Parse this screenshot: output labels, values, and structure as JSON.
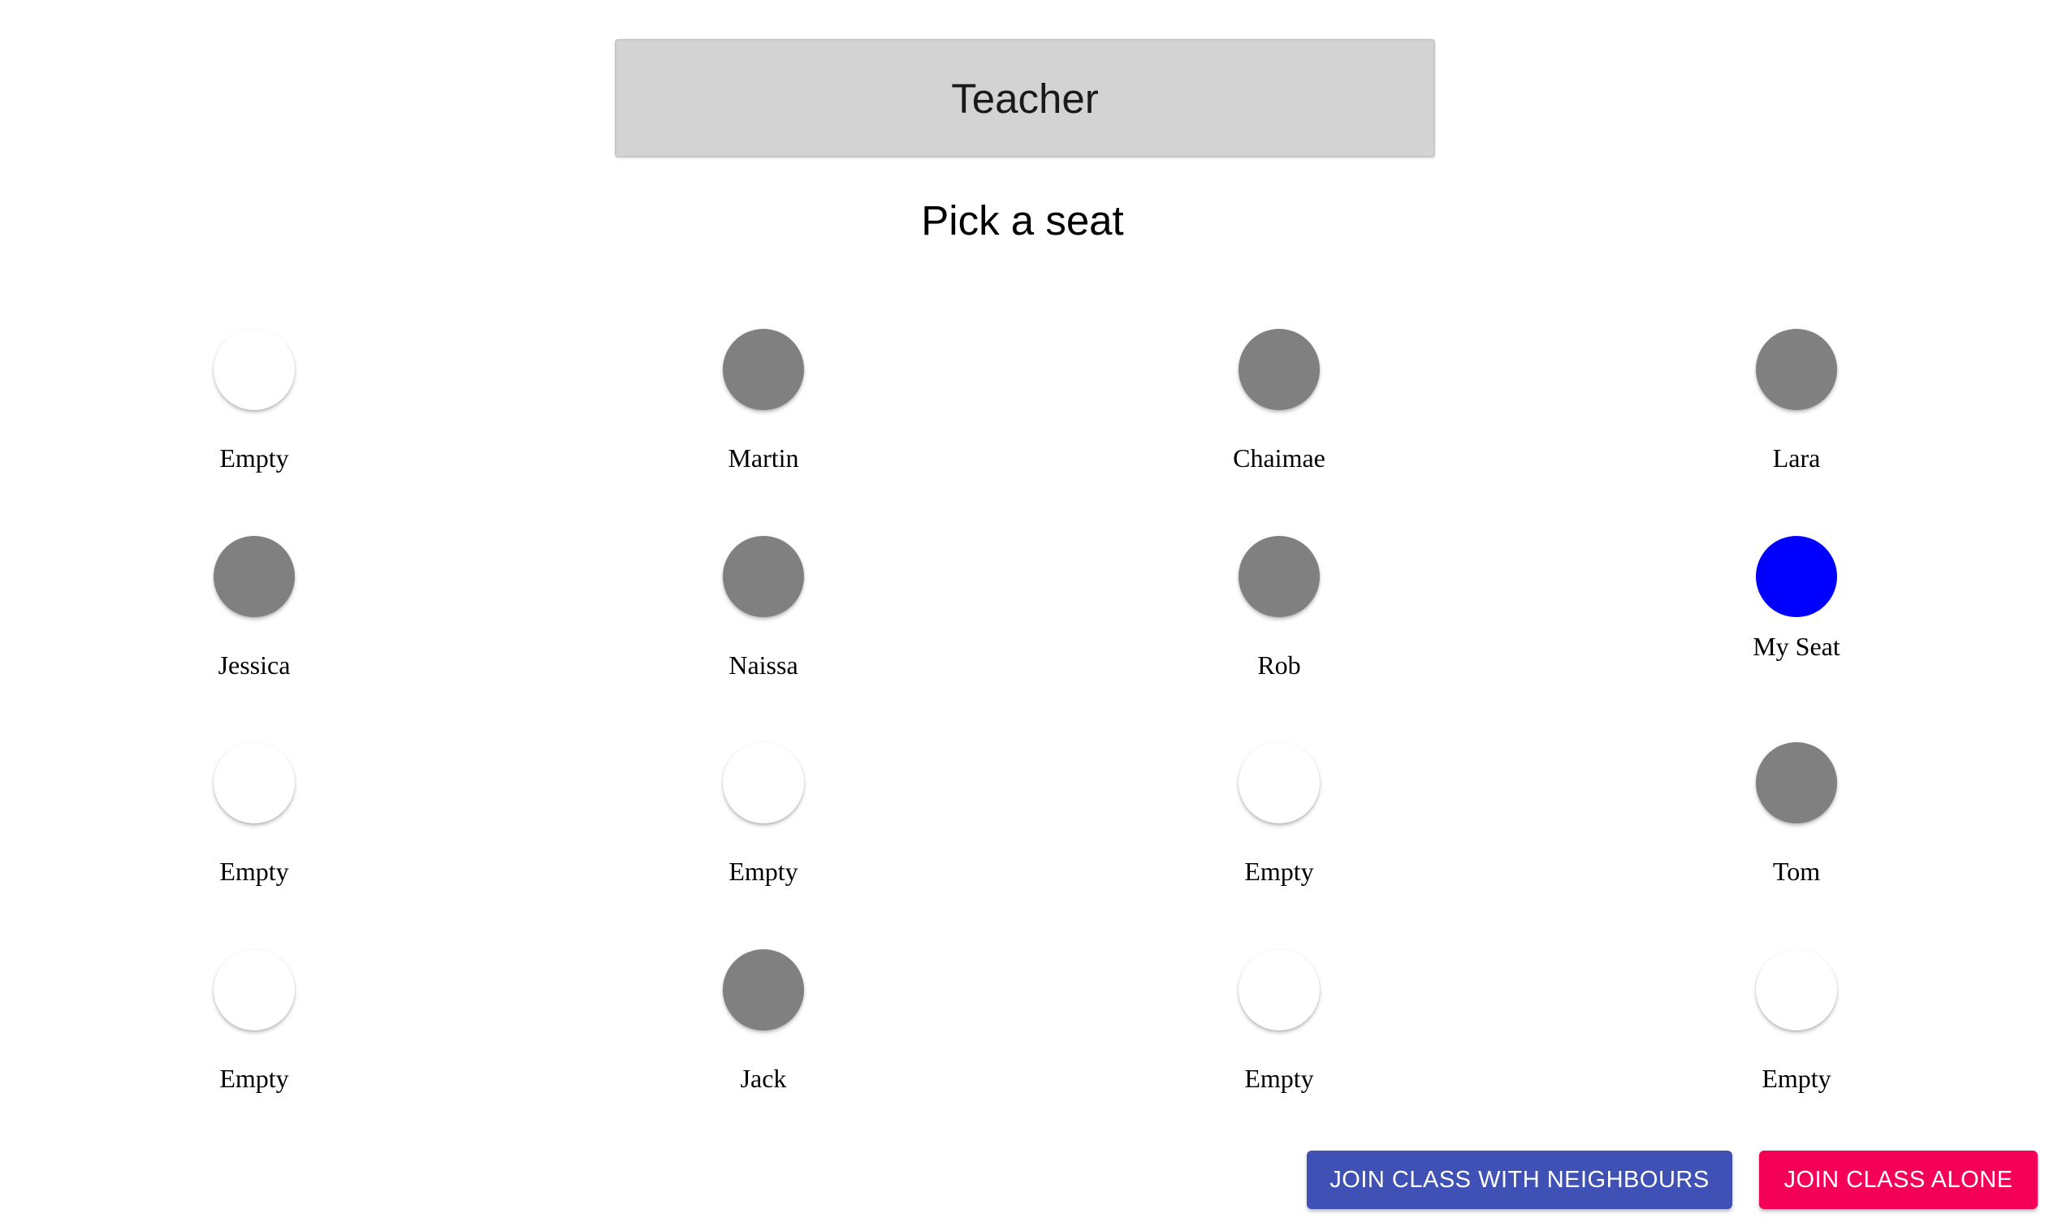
{
  "teacher": {
    "label": "Teacher"
  },
  "page_title": "Pick a seat",
  "seats": [
    {
      "label": "Empty",
      "state": "empty"
    },
    {
      "label": "Martin",
      "state": "taken"
    },
    {
      "label": "Chaimae",
      "state": "taken"
    },
    {
      "label": "Lara",
      "state": "taken"
    },
    {
      "label": "Jessica",
      "state": "taken"
    },
    {
      "label": "Naissa",
      "state": "taken"
    },
    {
      "label": "Rob",
      "state": "taken"
    },
    {
      "label": "My Seat",
      "state": "mine"
    },
    {
      "label": "Empty",
      "state": "empty"
    },
    {
      "label": "Empty",
      "state": "empty"
    },
    {
      "label": "Empty",
      "state": "empty"
    },
    {
      "label": "Tom",
      "state": "taken"
    },
    {
      "label": "Empty",
      "state": "empty"
    },
    {
      "label": "Jack",
      "state": "taken"
    },
    {
      "label": "Empty",
      "state": "empty"
    },
    {
      "label": "Empty",
      "state": "empty"
    }
  ],
  "colors": {
    "empty": "#ffffff",
    "taken": "#808080",
    "mine": "#0000ff",
    "primary_button": "#3f51b5",
    "secondary_button": "#f50057"
  },
  "buttons": {
    "join_with_neighbours": "JOIN CLASS WITH NEIGHBOURS",
    "join_alone": "JOIN CLASS ALONE"
  }
}
